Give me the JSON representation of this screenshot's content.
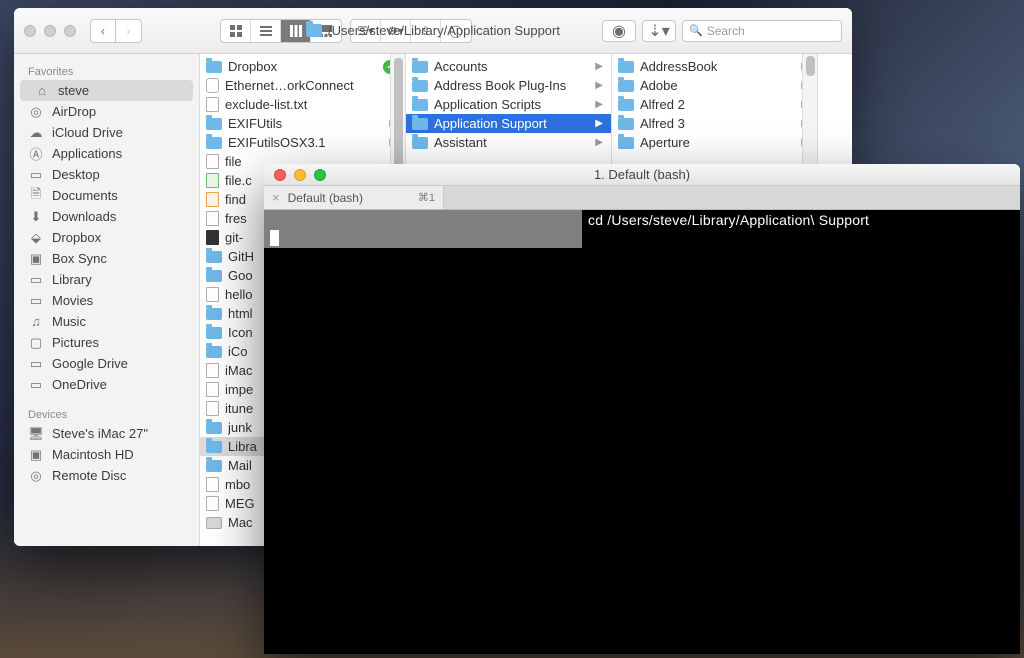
{
  "finder": {
    "title_path": "/Users/steve/Library/Application Support",
    "search_placeholder": "Search",
    "sidebar": {
      "favorites_header": "Favorites",
      "devices_header": "Devices",
      "items": [
        {
          "label": "steve",
          "icon": "home",
          "selected": true
        },
        {
          "label": "AirDrop",
          "icon": "airdrop"
        },
        {
          "label": "iCloud Drive",
          "icon": "cloud"
        },
        {
          "label": "Applications",
          "icon": "apps"
        },
        {
          "label": "Desktop",
          "icon": "desktop"
        },
        {
          "label": "Documents",
          "icon": "doc"
        },
        {
          "label": "Downloads",
          "icon": "download"
        },
        {
          "label": "Dropbox",
          "icon": "dropbox"
        },
        {
          "label": "Box Sync",
          "icon": "box"
        },
        {
          "label": "Library",
          "icon": "folder"
        },
        {
          "label": "Movies",
          "icon": "movie"
        },
        {
          "label": "Music",
          "icon": "music"
        },
        {
          "label": "Pictures",
          "icon": "picture"
        },
        {
          "label": "Google Drive",
          "icon": "folder"
        },
        {
          "label": "OneDrive",
          "icon": "folder"
        }
      ],
      "devices": [
        {
          "label": "Steve's iMac 27\"",
          "icon": "imac"
        },
        {
          "label": "Macintosh HD",
          "icon": "hd"
        },
        {
          "label": "Remote Disc",
          "icon": "disc"
        }
      ]
    },
    "column1": [
      {
        "label": "Dropbox",
        "type": "folder",
        "synced": true
      },
      {
        "label": "Ethernet…orkConnect",
        "type": "app"
      },
      {
        "label": "exclude-list.txt",
        "type": "file"
      },
      {
        "label": "EXIFUtils",
        "type": "folder",
        "chev": true
      },
      {
        "label": "EXIFutilsOSX3.1",
        "type": "folder",
        "chev": true
      },
      {
        "label": "file",
        "type": "file"
      },
      {
        "label": "file.c",
        "type": "file-green"
      },
      {
        "label": "find",
        "type": "file-orange"
      },
      {
        "label": "fres",
        "type": "file"
      },
      {
        "label": "git-",
        "type": "file-dark"
      },
      {
        "label": "GitH",
        "type": "folder"
      },
      {
        "label": "Goo",
        "type": "folder"
      },
      {
        "label": "hello",
        "type": "file"
      },
      {
        "label": "html",
        "type": "folder"
      },
      {
        "label": "Icon",
        "type": "folder"
      },
      {
        "label": "iCo",
        "type": "folder"
      },
      {
        "label": "iMac",
        "type": "file"
      },
      {
        "label": "impe",
        "type": "file"
      },
      {
        "label": "itune",
        "type": "file"
      },
      {
        "label": "junk",
        "type": "folder"
      },
      {
        "label": "Libra",
        "type": "folder",
        "selected": true
      },
      {
        "label": "Mail",
        "type": "folder"
      },
      {
        "label": "mbo",
        "type": "file"
      },
      {
        "label": "MEG",
        "type": "file"
      },
      {
        "label": "Mac",
        "type": "hd"
      }
    ],
    "column2": [
      {
        "label": "Accounts",
        "chev": true
      },
      {
        "label": "Address Book Plug-Ins",
        "chev": true
      },
      {
        "label": "Application Scripts",
        "chev": true
      },
      {
        "label": "Application Support",
        "chev": true,
        "selected": true
      },
      {
        "label": "Assistant",
        "chev": true
      }
    ],
    "column3": [
      {
        "label": "AddressBook",
        "chev": true
      },
      {
        "label": "Adobe",
        "chev": true
      },
      {
        "label": "Alfred 2",
        "chev": true
      },
      {
        "label": "Alfred 3",
        "chev": true
      },
      {
        "label": "Aperture",
        "chev": true
      }
    ]
  },
  "terminal": {
    "window_title": "1. Default (bash)",
    "tab_label": "Default (bash)",
    "tab_shortcut": "⌘1",
    "command": "cd /Users/steve/Library/Application\\ Support"
  }
}
